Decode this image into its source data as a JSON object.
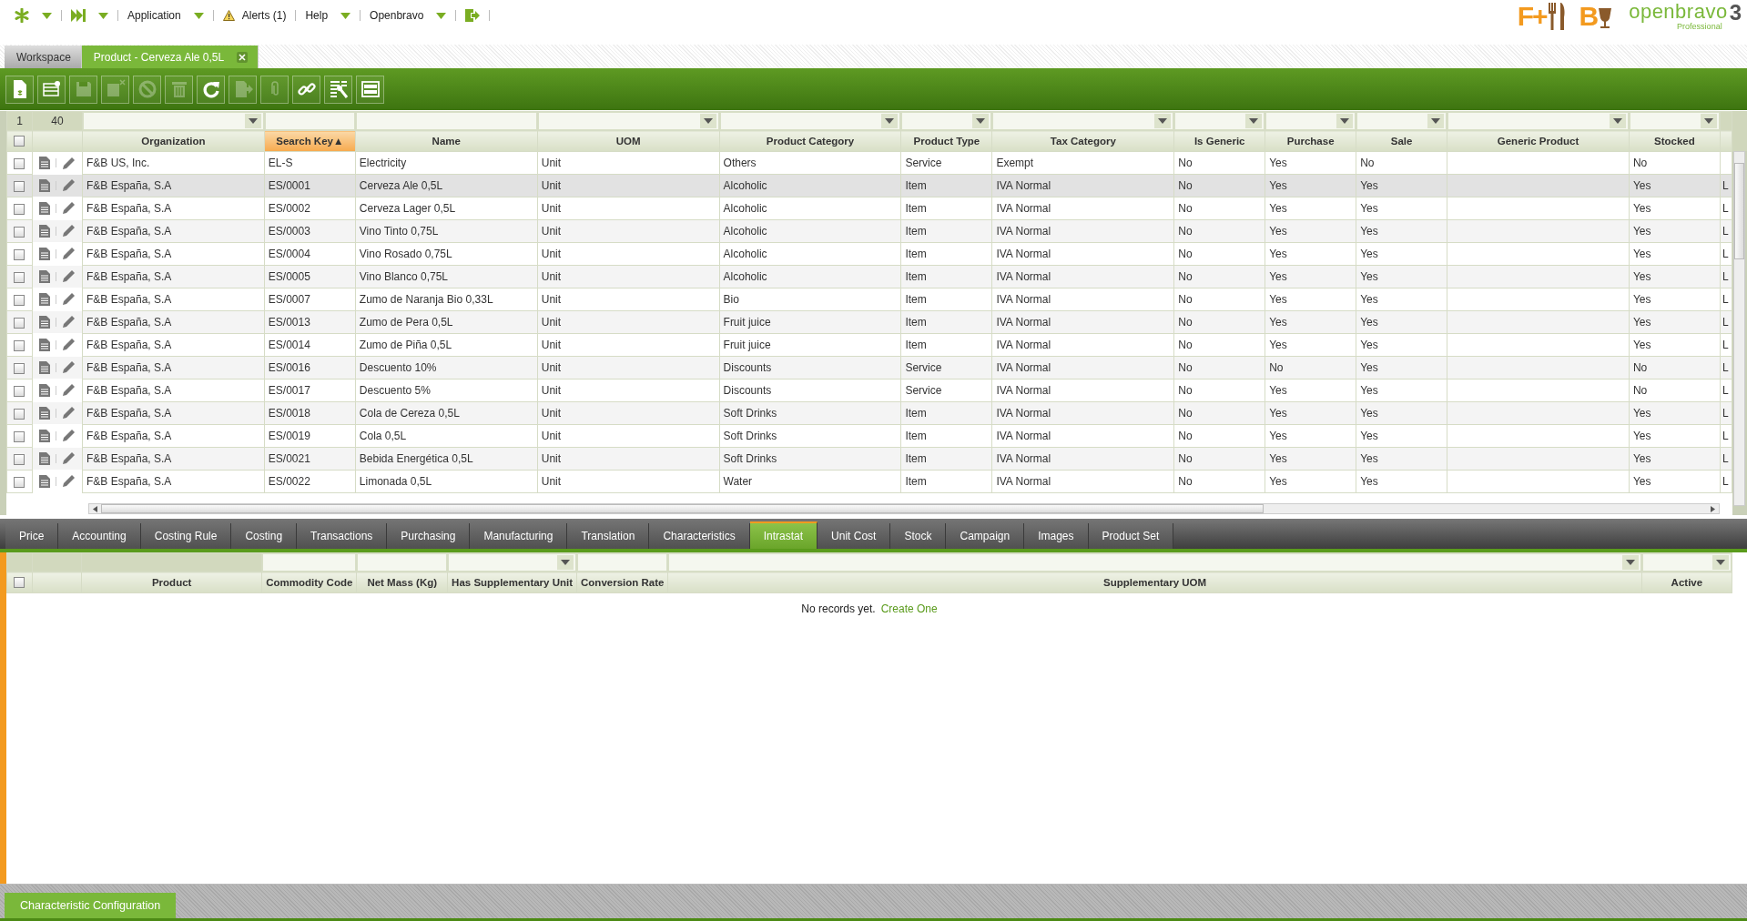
{
  "top_menu": [
    {
      "kind": "launch",
      "dropdown": true
    },
    {
      "kind": "create",
      "dropdown": true
    },
    {
      "kind": "text",
      "label": "Application",
      "dropdown": true
    },
    {
      "kind": "alert",
      "label": "Alerts (1)",
      "dropdown": false
    },
    {
      "kind": "text",
      "label": "Help",
      "dropdown": true
    },
    {
      "kind": "text",
      "label": "Openbravo",
      "dropdown": true
    },
    {
      "kind": "logout",
      "dropdown": false
    }
  ],
  "partner_logo": {
    "left": "F+",
    "right": "B"
  },
  "brand_logo": {
    "name": "openbravo",
    "edition": "Professional",
    "version": "3"
  },
  "window_tabs": [
    {
      "label": "Workspace",
      "selected": false,
      "closable": false
    },
    {
      "label": "Product - Cerveza Ale 0,5L",
      "selected": true,
      "closable": true
    }
  ],
  "toolbar": [
    {
      "kind": "new-document",
      "disabled": false
    },
    {
      "kind": "new-row",
      "disabled": false
    },
    {
      "kind": "save",
      "disabled": true
    },
    {
      "kind": "save-close",
      "disabled": true
    },
    {
      "kind": "cancel",
      "disabled": true
    },
    {
      "kind": "delete",
      "disabled": true
    },
    {
      "kind": "refresh",
      "disabled": false
    },
    {
      "kind": "export",
      "disabled": true
    },
    {
      "kind": "attach",
      "disabled": true
    },
    {
      "kind": "link",
      "disabled": false
    },
    {
      "kind": "tools",
      "disabled": false
    },
    {
      "kind": "form-view",
      "disabled": false
    }
  ],
  "grid": {
    "select_all_checked": false,
    "record_range": {
      "first": "1",
      "count": "40"
    },
    "columns": [
      {
        "label": "Organization",
        "kind": "dropdown",
        "sorted": false
      },
      {
        "label": "Search Key",
        "kind": "text",
        "sorted": true,
        "sort_arrow": "▲"
      },
      {
        "label": "Name",
        "kind": "text",
        "sorted": false
      },
      {
        "label": "UOM",
        "kind": "dropdown",
        "sorted": false
      },
      {
        "label": "Product Category",
        "kind": "dropdown",
        "sorted": false
      },
      {
        "label": "Product Type",
        "kind": "dropdown",
        "sorted": false
      },
      {
        "label": "Tax Category",
        "kind": "dropdown",
        "sorted": false
      },
      {
        "label": "Is Generic",
        "kind": "dropdown",
        "sorted": false
      },
      {
        "label": "Purchase",
        "kind": "dropdown",
        "sorted": false
      },
      {
        "label": "Sale",
        "kind": "dropdown",
        "sorted": false
      },
      {
        "label": "Generic Product",
        "kind": "dropdown",
        "sorted": false
      },
      {
        "label": "Stocked",
        "kind": "dropdown",
        "sorted": false
      }
    ],
    "rows": [
      {
        "selected": false,
        "checked": false,
        "cells": [
          "F&B US, Inc.",
          "EL-S",
          "Electricity",
          "Unit",
          "Others",
          "Service",
          "Exempt",
          "No",
          "Yes",
          "No",
          null,
          "No"
        ]
      },
      {
        "selected": true,
        "checked": false,
        "cells": [
          "F&B España, S.A",
          "ES/0001",
          "Cerveza Ale 0,5L",
          "Unit",
          "Alcoholic",
          "Item",
          "IVA Normal",
          "No",
          "Yes",
          "Yes",
          null,
          "Yes"
        ],
        "column_13": "L"
      },
      {
        "selected": false,
        "checked": false,
        "cells": [
          "F&B España, S.A",
          "ES/0002",
          "Cerveza Lager 0,5L",
          "Unit",
          "Alcoholic",
          "Item",
          "IVA Normal",
          "No",
          "Yes",
          "Yes",
          null,
          "Yes"
        ],
        "column_13": "L"
      },
      {
        "selected": false,
        "checked": false,
        "cells": [
          "F&B España, S.A",
          "ES/0003",
          "Vino Tinto 0,75L",
          "Unit",
          "Alcoholic",
          "Item",
          "IVA Normal",
          "No",
          "Yes",
          "Yes",
          null,
          "Yes"
        ],
        "column_13": "L"
      },
      {
        "selected": false,
        "checked": false,
        "cells": [
          "F&B España, S.A",
          "ES/0004",
          "Vino Rosado 0,75L",
          "Unit",
          "Alcoholic",
          "Item",
          "IVA Normal",
          "No",
          "Yes",
          "Yes",
          null,
          "Yes"
        ],
        "column_13": "L"
      },
      {
        "selected": false,
        "checked": false,
        "cells": [
          "F&B España, S.A",
          "ES/0005",
          "Vino Blanco 0,75L",
          "Unit",
          "Alcoholic",
          "Item",
          "IVA Normal",
          "No",
          "Yes",
          "Yes",
          null,
          "Yes"
        ],
        "column_13": "L"
      },
      {
        "selected": false,
        "checked": false,
        "cells": [
          "F&B España, S.A",
          "ES/0007",
          "Zumo de Naranja Bio 0,33L",
          "Unit",
          "Bio",
          "Item",
          "IVA Normal",
          "No",
          "Yes",
          "Yes",
          null,
          "Yes"
        ],
        "column_13": "L"
      },
      {
        "selected": false,
        "checked": false,
        "cells": [
          "F&B España, S.A",
          "ES/0013",
          "Zumo de Pera 0,5L",
          "Unit",
          "Fruit juice",
          "Item",
          "IVA Normal",
          "No",
          "Yes",
          "Yes",
          null,
          "Yes"
        ],
        "column_13": "L"
      },
      {
        "selected": false,
        "checked": false,
        "cells": [
          "F&B España, S.A",
          "ES/0014",
          "Zumo de Piña 0,5L",
          "Unit",
          "Fruit juice",
          "Item",
          "IVA Normal",
          "No",
          "Yes",
          "Yes",
          null,
          "Yes"
        ],
        "column_13": "L"
      },
      {
        "selected": false,
        "checked": false,
        "cells": [
          "F&B España, S.A",
          "ES/0016",
          "Descuento 10%",
          "Unit",
          "Discounts",
          "Service",
          "IVA Normal",
          "No",
          "No",
          "Yes",
          null,
          "No"
        ],
        "column_13": "L"
      },
      {
        "selected": false,
        "checked": false,
        "cells": [
          "F&B España, S.A",
          "ES/0017",
          "Descuento 5%",
          "Unit",
          "Discounts",
          "Service",
          "IVA Normal",
          "No",
          "Yes",
          "Yes",
          null,
          "No"
        ],
        "column_13": "L"
      },
      {
        "selected": false,
        "checked": false,
        "cells": [
          "F&B España, S.A",
          "ES/0018",
          "Cola de Cereza 0,5L",
          "Unit",
          "Soft Drinks",
          "Item",
          "IVA Normal",
          "No",
          "Yes",
          "Yes",
          null,
          "Yes"
        ],
        "column_13": "L"
      },
      {
        "selected": false,
        "checked": false,
        "cells": [
          "F&B España, S.A",
          "ES/0019",
          "Cola 0,5L",
          "Unit",
          "Soft Drinks",
          "Item",
          "IVA Normal",
          "No",
          "Yes",
          "Yes",
          null,
          "Yes"
        ],
        "column_13": "L"
      },
      {
        "selected": false,
        "checked": false,
        "cells": [
          "F&B España, S.A",
          "ES/0021",
          "Bebida Energética 0,5L",
          "Unit",
          "Soft Drinks",
          "Item",
          "IVA Normal",
          "No",
          "Yes",
          "Yes",
          null,
          "Yes"
        ],
        "column_13": "L"
      },
      {
        "selected": false,
        "checked": false,
        "cells": [
          "F&B España, S.A",
          "ES/0022",
          "Limonada 0,5L",
          "Unit",
          "Water",
          "Item",
          "IVA Normal",
          "No",
          "Yes",
          "Yes",
          null,
          "Yes"
        ],
        "column_13": "L"
      }
    ]
  },
  "child_tabs": [
    {
      "label": "Price",
      "selected": false
    },
    {
      "label": "Accounting",
      "selected": false
    },
    {
      "label": "Costing Rule",
      "selected": false
    },
    {
      "label": "Costing",
      "selected": false
    },
    {
      "label": "Transactions",
      "selected": false
    },
    {
      "label": "Purchasing",
      "selected": false
    },
    {
      "label": "Manufacturing",
      "selected": false
    },
    {
      "label": "Translation",
      "selected": false
    },
    {
      "label": "Characteristics",
      "selected": false
    },
    {
      "label": "Intrastat",
      "selected": true
    },
    {
      "label": "Unit Cost",
      "selected": false
    },
    {
      "label": "Stock",
      "selected": false
    },
    {
      "label": "Campaign",
      "selected": false
    },
    {
      "label": "Images",
      "selected": false
    },
    {
      "label": "Product Set",
      "selected": false
    }
  ],
  "child_grid": {
    "select_all_checked": false,
    "columns": [
      {
        "label": "Product",
        "kind": "none"
      },
      {
        "label": "Commodity Code",
        "kind": "text"
      },
      {
        "label": "Net Mass (Kg)",
        "kind": "text"
      },
      {
        "label": "Has Supplementary Unit",
        "kind": "dropdown"
      },
      {
        "label": "Conversion Rate",
        "kind": "text"
      },
      {
        "label": "Supplementary UOM",
        "kind": "dropdown"
      },
      {
        "label": "Active",
        "kind": "dropdown"
      }
    ],
    "empty_message": "No records yet.",
    "create_link": "Create One"
  },
  "bottom_tabs": [
    {
      "label": "Characteristic Configuration",
      "selected": true
    }
  ]
}
